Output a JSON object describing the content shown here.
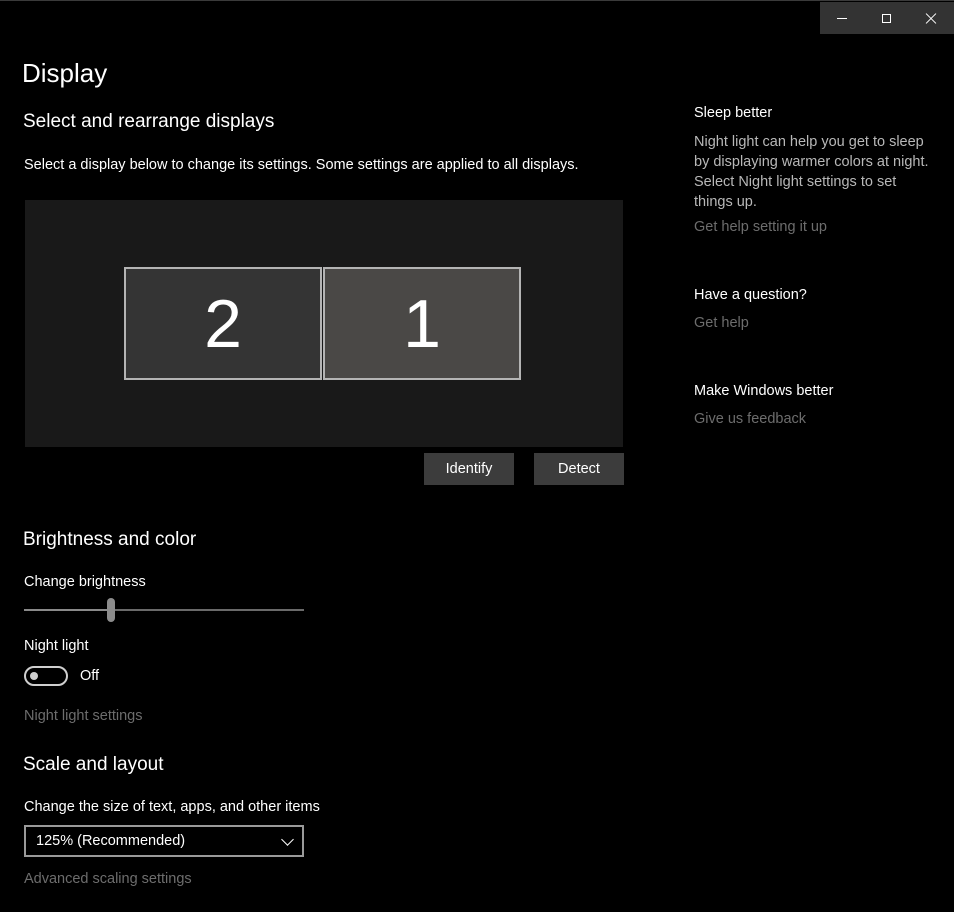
{
  "window": {
    "title": "Display",
    "controls": {
      "minimize_icon": "minimize-icon",
      "maximize_icon": "maximize-icon",
      "close_icon": "close-icon"
    }
  },
  "arrange": {
    "heading": "Select and rearrange displays",
    "description": "Select a display below to change its settings. Some settings are applied to all displays.",
    "monitors": [
      {
        "label": "2",
        "selected": false
      },
      {
        "label": "1",
        "selected": true
      }
    ],
    "identify_label": "Identify",
    "detect_label": "Detect"
  },
  "brightness": {
    "heading": "Brightness and color",
    "change_brightness_label": "Change brightness",
    "brightness_level": 0.31,
    "night_light_label": "Night light",
    "night_light_state": "Off",
    "night_light_settings_link": "Night light settings"
  },
  "scale": {
    "heading": "Scale and layout",
    "size_label": "Change the size of text, apps, and other items",
    "size_value": "125% (Recommended)",
    "advanced_link": "Advanced scaling settings"
  },
  "sidebar": {
    "sleep_heading": "Sleep better",
    "sleep_text": "Night light can help you get to sleep by displaying warmer colors at night. Select Night light settings to set things up.",
    "sleep_link": "Get help setting it up",
    "question_heading": "Have a question?",
    "question_link": "Get help",
    "feedback_heading": "Make Windows better",
    "feedback_link": "Give us feedback"
  },
  "colors": {
    "background": "#000000",
    "button": "#3c3c3c",
    "link_dim": "#6d6d6d"
  }
}
